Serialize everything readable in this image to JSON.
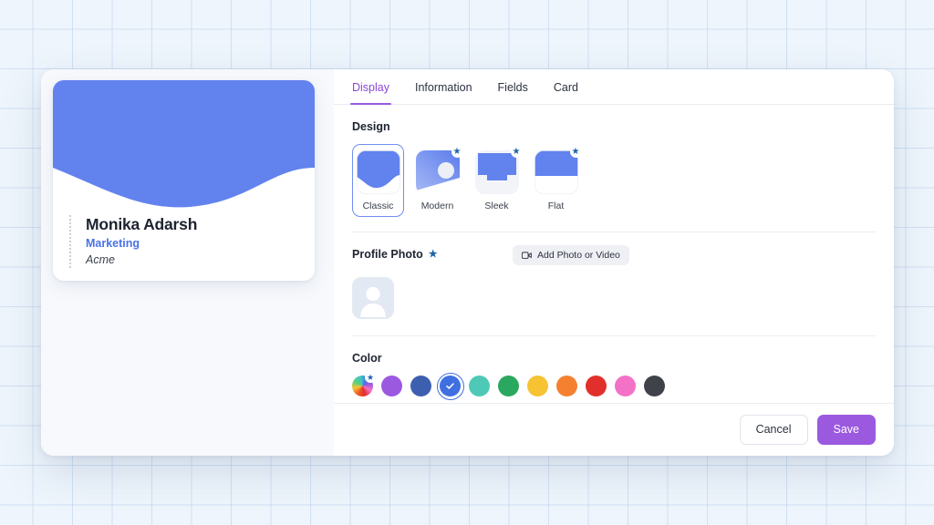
{
  "card_preview": {
    "name": "Monika Adarsh",
    "role": "Marketing",
    "company": "Acme",
    "banner_color": "#6282ee",
    "role_color": "#4a72e8"
  },
  "tabs": [
    {
      "label": "Display",
      "active": true
    },
    {
      "label": "Information",
      "active": false
    },
    {
      "label": "Fields",
      "active": false
    },
    {
      "label": "Card",
      "active": false
    }
  ],
  "design": {
    "title": "Design",
    "options": [
      {
        "label": "Classic",
        "selected": true,
        "premium": false
      },
      {
        "label": "Modern",
        "selected": false,
        "premium": true
      },
      {
        "label": "Sleek",
        "selected": false,
        "premium": true
      },
      {
        "label": "Flat",
        "selected": false,
        "premium": true
      }
    ]
  },
  "profile_photo": {
    "title": "Profile Photo",
    "premium": true,
    "add_button_label": "Add Photo or Video",
    "add_button_icon": "camera-icon",
    "placeholder_icon": "person-avatar-icon"
  },
  "color": {
    "title": "Color",
    "swatches": [
      {
        "name": "rainbow",
        "hex": "gradient",
        "selected": false,
        "premium": true
      },
      {
        "name": "purple",
        "hex": "#9b59e0",
        "selected": false,
        "premium": false
      },
      {
        "name": "indigo",
        "hex": "#3d5fb0",
        "selected": false,
        "premium": false
      },
      {
        "name": "blue",
        "hex": "#3f6fe0",
        "selected": true,
        "premium": false
      },
      {
        "name": "teal",
        "hex": "#4ec9b8",
        "selected": false,
        "premium": false
      },
      {
        "name": "green",
        "hex": "#2aa85f",
        "selected": false,
        "premium": false
      },
      {
        "name": "yellow",
        "hex": "#f7c333",
        "selected": false,
        "premium": false
      },
      {
        "name": "orange",
        "hex": "#f58030",
        "selected": false,
        "premium": false
      },
      {
        "name": "red",
        "hex": "#e12f2b",
        "selected": false,
        "premium": false
      },
      {
        "name": "pink",
        "hex": "#f471c8",
        "selected": false,
        "premium": false
      },
      {
        "name": "charcoal",
        "hex": "#3f4248",
        "selected": false,
        "premium": false
      }
    ]
  },
  "footer": {
    "cancel_label": "Cancel",
    "save_label": "Save",
    "save_color": "#9b59e0"
  },
  "icons": {
    "star": "★",
    "check": "✓"
  }
}
